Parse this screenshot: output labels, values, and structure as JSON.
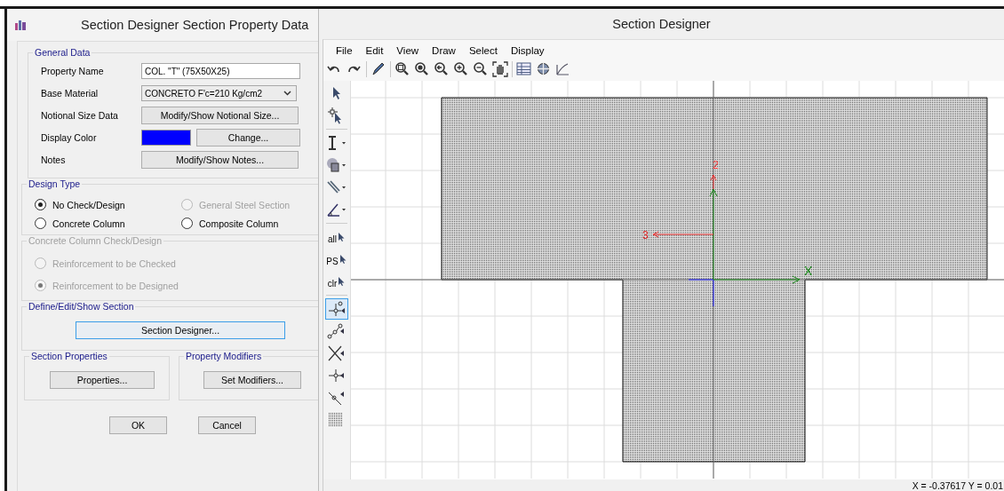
{
  "dialog": {
    "title": "Section Designer Section Property Data",
    "general_data": {
      "title": "General Data",
      "property_name": {
        "label": "Property Name",
        "value": "COL. \"T\" (75X50X25)"
      },
      "base_material": {
        "label": "Base Material",
        "value": "CONCRETO F'c=210 Kg/cm2"
      },
      "notional_size": {
        "label": "Notional Size Data",
        "button": "Modify/Show Notional Size..."
      },
      "display_color": {
        "label": "Display Color",
        "color": "#0000ff",
        "button": "Change..."
      },
      "notes": {
        "label": "Notes",
        "button": "Modify/Show Notes..."
      }
    },
    "design_type": {
      "title": "Design Type",
      "options": [
        {
          "label": "No Check/Design",
          "selected": true,
          "disabled": false
        },
        {
          "label": "General Steel Section",
          "selected": false,
          "disabled": true
        },
        {
          "label": "Concrete Column",
          "selected": false,
          "disabled": false
        },
        {
          "label": "Composite Column",
          "selected": false,
          "disabled": false
        }
      ]
    },
    "concrete_check": {
      "title": "Concrete Column Check/Design",
      "disabled": true,
      "options": [
        {
          "label": "Reinforcement to be Checked",
          "selected": false
        },
        {
          "label": "Reinforcement to be Designed",
          "selected": true
        }
      ]
    },
    "define_section": {
      "title": "Define/Edit/Show Section",
      "button": "Section Designer..."
    },
    "section_properties": {
      "title": "Section Properties",
      "button": "Properties..."
    },
    "property_modifiers": {
      "title": "Property Modifiers",
      "button": "Set Modifiers..."
    },
    "buttons": [
      "OK",
      "Cancel"
    ]
  },
  "designer": {
    "title": "Section Designer",
    "menu": [
      "File",
      "Edit",
      "View",
      "Draw",
      "Select",
      "Display"
    ],
    "tools": [
      {
        "kind": "pointer",
        "selected": false
      },
      {
        "kind": "reshape",
        "selected": false
      },
      {
        "kind": "shape",
        "selected": false
      },
      {
        "kind": "polygon",
        "selected": false
      },
      {
        "kind": "line",
        "selected": false
      },
      {
        "kind": "rebar",
        "selected": false
      },
      {
        "kind": "select",
        "label": "all",
        "selected": false
      },
      {
        "kind": "select",
        "label": "PS",
        "selected": false
      },
      {
        "kind": "select",
        "label": "clr",
        "selected": false
      },
      {
        "kind": "snap-point",
        "selected": true
      },
      {
        "kind": "snap-line",
        "selected": false
      },
      {
        "kind": "snap-cross",
        "selected": false
      },
      {
        "kind": "snap-mid",
        "selected": false
      },
      {
        "kind": "snap-perp",
        "selected": false
      },
      {
        "kind": "snap-grid",
        "selected": false
      }
    ],
    "canvas": {
      "axis_2": "2",
      "axis_3": "3",
      "axis_x": "X"
    },
    "status": "X = -0.37617   Y = 0.01"
  }
}
